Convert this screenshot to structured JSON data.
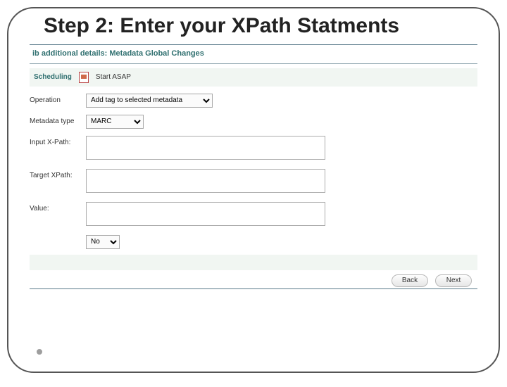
{
  "slide": {
    "title": "Step 2: Enter your XPath Statments"
  },
  "header": {
    "breadcrumb": "ib additional details: Metadata Global Changes"
  },
  "scheduling": {
    "label": "Scheduling",
    "text": "Start ASAP"
  },
  "form": {
    "operation_label": "Operation",
    "operation_value": "Add tag to selected metadata",
    "metadata_type_label": "Metadata type",
    "metadata_type_value": "MARC",
    "input_xpath_label": "Input X-Path:",
    "input_xpath_value": "",
    "target_xpath_label": "Target XPath:",
    "target_xpath_value": "",
    "value_label": "Value:",
    "value_value": "",
    "last_label": "",
    "last_value": "No"
  },
  "buttons": {
    "back": "Back",
    "next": "Next"
  }
}
